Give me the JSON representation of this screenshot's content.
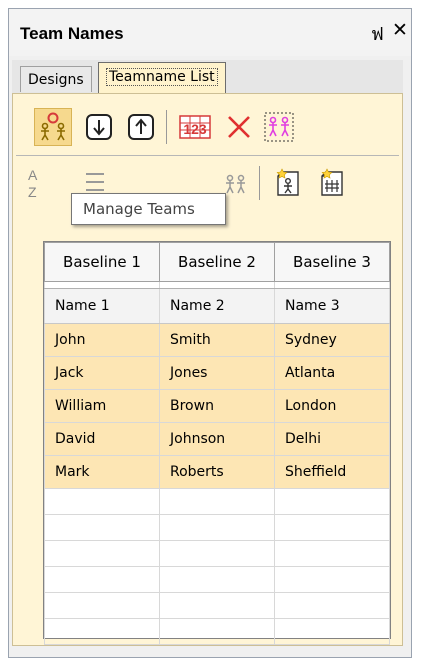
{
  "panel": {
    "title": "Team Names",
    "pin_glyph": "ฟ",
    "close_glyph": "✕"
  },
  "tabs": [
    {
      "label": "Designs",
      "active": false
    },
    {
      "label": "Teamname List",
      "active": true
    }
  ],
  "toolbar": {
    "row1": [
      {
        "name": "manage-teams-icon",
        "pressed": true
      },
      {
        "name": "move-down-icon"
      },
      {
        "name": "move-up-icon"
      },
      {
        "name": "numbering-icon"
      },
      {
        "name": "delete-icon"
      },
      {
        "name": "select-team-icon"
      }
    ],
    "row2": [
      {
        "name": "sort-az-icon"
      },
      {
        "name": "sort-icon"
      },
      {
        "name": "team-icon"
      },
      {
        "name": "import-icon"
      },
      {
        "name": "import-list-icon"
      }
    ],
    "tooltip": "Manage Teams",
    "accent_color": "#d63a3a"
  },
  "grid": {
    "headers": [
      "Baseline 1",
      "Baseline 2",
      "Baseline 3"
    ],
    "subheaders": [
      "Name 1",
      "Name 2",
      "Name 3"
    ],
    "rows": [
      [
        "John",
        "Smith",
        "Sydney"
      ],
      [
        "Jack",
        "Jones",
        "Atlanta"
      ],
      [
        "William",
        "Brown",
        "London"
      ],
      [
        "David",
        "Johnson",
        "Delhi"
      ],
      [
        "Mark",
        "Roberts",
        "Sheffield"
      ]
    ],
    "row_highlight_color": "#fde6b4"
  }
}
